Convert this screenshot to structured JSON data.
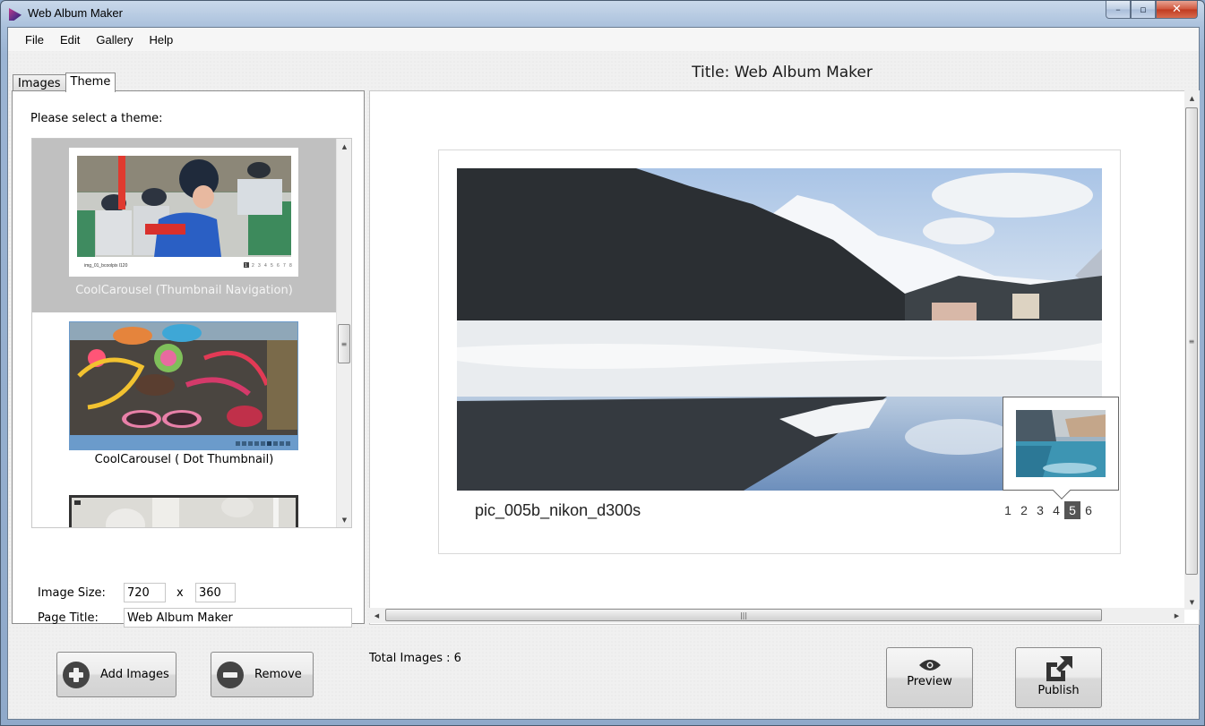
{
  "window": {
    "title": "Web Album Maker",
    "controls": {
      "minimize": "–",
      "maximize": "▫",
      "close": "✕"
    }
  },
  "menu": [
    {
      "label": "File"
    },
    {
      "label": "Edit"
    },
    {
      "label": "Gallery"
    },
    {
      "label": "Help"
    }
  ],
  "tabs": [
    {
      "label": "Images",
      "active": false
    },
    {
      "label": "Theme",
      "active": true
    }
  ],
  "theme_panel": {
    "prompt": "Please select a theme:",
    "themes": [
      {
        "label": "CoolCarousel (Thumbnail Navigation)",
        "selected": true,
        "thumb_caption": "img_01_bcoolpix l120",
        "thumb_pages": [
          "1",
          "2",
          "3",
          "4",
          "5",
          "6",
          "7",
          "8"
        ]
      },
      {
        "label": "CoolCarousel ( Dot Thumbnail)",
        "selected": false,
        "dot_count": 9,
        "dot_active_index": 5
      },
      {
        "label": "",
        "selected": false
      }
    ],
    "image_size_label": "Image Size:",
    "image_width": "720",
    "size_separator": "x",
    "image_height": "360",
    "page_title_label": "Page Title:",
    "page_title_value": "Web Album Maker"
  },
  "preview": {
    "title_display": "Title: Web Album Maker",
    "caption": "pic_005b_nikon_d300s",
    "pages": [
      "1",
      "2",
      "3",
      "4",
      "5",
      "6"
    ],
    "active_page": "5"
  },
  "bottom": {
    "add_images_label": "Add Images",
    "remove_label": "Remove",
    "total_images": "Total Images : 6",
    "preview_label": "Preview",
    "publish_label": "Publish"
  },
  "colors": {
    "selected_theme_bg": "#c0c0c0",
    "dot_bar": "#6b9bcb",
    "active_page_bg": "#555555",
    "close_button": "#c8452a"
  }
}
